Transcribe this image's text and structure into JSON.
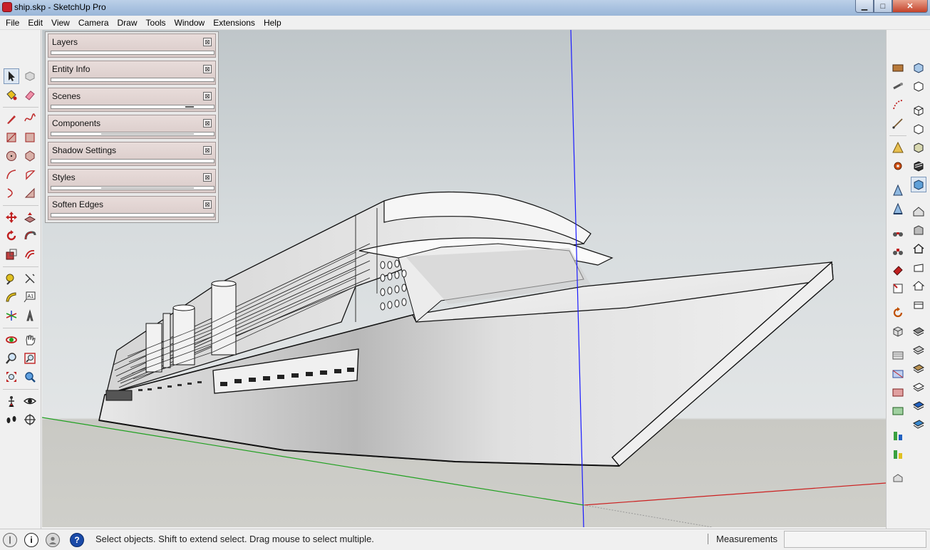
{
  "window": {
    "title": "ship.skp - SketchUp Pro",
    "min_label": "▁",
    "max_label": "□",
    "close_label": "✕"
  },
  "menu": {
    "items": [
      "File",
      "Edit",
      "View",
      "Camera",
      "Draw",
      "Tools",
      "Window",
      "Extensions",
      "Help"
    ]
  },
  "tray": {
    "panels": [
      {
        "title": "Layers"
      },
      {
        "title": "Entity Info"
      },
      {
        "title": "Scenes"
      },
      {
        "title": "Components"
      },
      {
        "title": "Shadow Settings"
      },
      {
        "title": "Styles"
      },
      {
        "title": "Soften Edges"
      }
    ],
    "close_glyph": "⊠"
  },
  "left_toolbar": {
    "tools": [
      "select",
      "make-component",
      "paint-bucket",
      "eraser",
      "pencil",
      "freehand",
      "rectangle",
      "rotated-rectangle",
      "circle",
      "polygon",
      "arc",
      "pie",
      "two-point-arc",
      "three-point-arc",
      "move",
      "push-pull",
      "rotate",
      "follow-me",
      "scale",
      "offset",
      "tape-measure",
      "dimension",
      "protractor",
      "text",
      "axes",
      "3d-text",
      "orbit",
      "pan",
      "zoom",
      "zoom-window",
      "zoom-extents",
      "previous-view",
      "position-camera",
      "look-around",
      "walk",
      "section-plane"
    ]
  },
  "right_toolbar": {
    "tools": [
      "outliner",
      "tape",
      "arc-3pt",
      "line",
      "warehouse",
      "gear",
      "measure-a",
      "measure-b",
      "iso-view",
      "top-view",
      "front-view",
      "right-view",
      "back-view",
      "left-view",
      "xray",
      "back-edges",
      "wireframe",
      "hidden-line",
      "shaded",
      "shaded-textures",
      "monochrome",
      "house-a",
      "house-b",
      "house-c",
      "house-d"
    ]
  },
  "status": {
    "message": "Select objects. Shift to extend select. Drag mouse to select multiple.",
    "measurements_label": "Measurements",
    "measurements_value": "",
    "help_glyph": "?",
    "info_glyph": "i"
  },
  "colors": {
    "title_bar": "#a9c2e0",
    "blue_axis": "#1a1aff",
    "red_axis": "#cc2020",
    "green_axis": "#20a020",
    "close_button": "#c4432b"
  }
}
